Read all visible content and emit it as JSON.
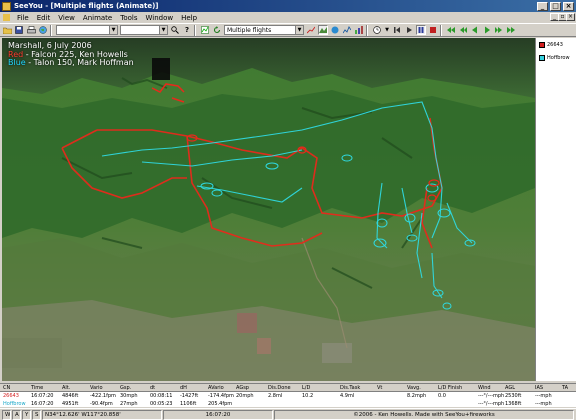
{
  "window": {
    "title": "SeeYou - [Multiple flights (Animate)]"
  },
  "window_controls": {
    "minimize": "_",
    "maximize": "□",
    "close": "×"
  },
  "mdi_controls": {
    "minimize": "_",
    "restore": "▫",
    "close": "×"
  },
  "menu": {
    "items": [
      "File",
      "Edit",
      "View",
      "Animate",
      "Tools",
      "Window",
      "Help"
    ]
  },
  "toolbar": {
    "flights_combo": "Multiple flights"
  },
  "map": {
    "legend_line1": "Marshall, 6 July 2006",
    "legend_red_word": "Red",
    "legend_line2": " - Falcon 225, Ken Howells",
    "legend_blue_word": "Blue",
    "legend_line3": " - Talon 150, Mark Hoffman",
    "colors": {
      "red_track": "#e8291b",
      "blue_track": "#2fd9e0"
    }
  },
  "pilots": [
    {
      "name": "26643",
      "color": "#d42020"
    },
    {
      "name": "Hoffbrow",
      "color": "#35d2e0"
    }
  ],
  "table": {
    "headers": [
      "CN",
      "Time",
      "Alt.",
      "Vario",
      "Gsp.",
      "dt",
      "dH",
      "AVario",
      "AGsp",
      "Dis.Done",
      "L/D",
      "Dis.Task",
      "Vt",
      "Vavg.",
      "L/D Finish",
      "Wind",
      "AGL",
      "IAS",
      "TA"
    ],
    "rows": [
      [
        "26643",
        "16:07:20",
        "4846ft",
        "-422.1fpm",
        "30mph",
        "00:08:11",
        "-1427ft",
        "-174.4fpm",
        "20mph",
        "2.8ml",
        "10.2",
        "4.9ml",
        "",
        "8.2mph",
        "0.0",
        "---°/---mph",
        "2530ft",
        "---mph",
        ""
      ],
      [
        "Hoffbrow",
        "16:07:20",
        "4951ft",
        "-90.4fpm",
        "27mph",
        "00:05:23",
        "1106ft",
        "205.4fpm",
        "",
        "",
        "",
        "",
        "",
        "",
        "",
        "---°/---mph",
        "1368ft",
        "---mph",
        ""
      ]
    ]
  },
  "status": {
    "mode_letters": [
      "W",
      "A",
      "Y",
      "S"
    ],
    "coords": "N34°12.626' W117°20.858'",
    "time": "16:07:20",
    "copyright": "©2006 - Ken Howells. Made with SeeYou+fireworks"
  }
}
